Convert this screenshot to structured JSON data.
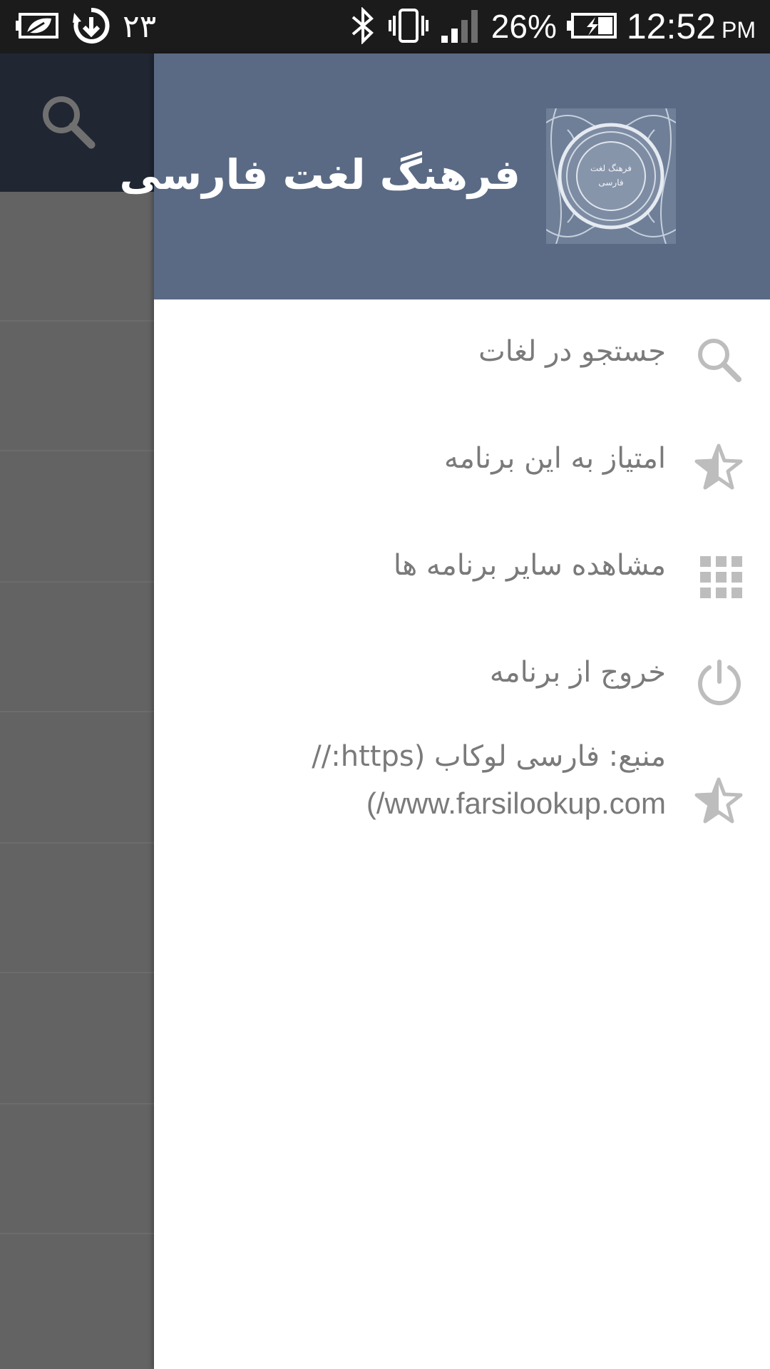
{
  "status_bar": {
    "left_number": "۲۳",
    "battery_percent": "26%",
    "time": "12:52",
    "ampm": "PM"
  },
  "drawer": {
    "title": "فرهنگ لغت فارسی",
    "logo_text": "فرهنگ لغت فارسی",
    "items": [
      {
        "label": "جستجو در لغات",
        "icon": "search-icon"
      },
      {
        "label": "امتیاز به این برنامه",
        "icon": "star-half-icon"
      },
      {
        "label": "مشاهده سایر برنامه ها",
        "icon": "apps-grid-icon"
      },
      {
        "label": "خروج از برنامه",
        "icon": "power-icon"
      },
      {
        "label": "منبع: فارسی لوکاب (https://",
        "label_line2": "(/www.farsilookup.com",
        "icon": "star-half-icon"
      }
    ]
  },
  "colors": {
    "status_bar": "#1b1b1b",
    "toolbar": "#202632",
    "drawer_header": "#5a6a84",
    "drawer_bg": "#ffffff",
    "menu_text": "#7a7a7a",
    "menu_icon": "#bdbdbd",
    "scrim": "#636363"
  }
}
